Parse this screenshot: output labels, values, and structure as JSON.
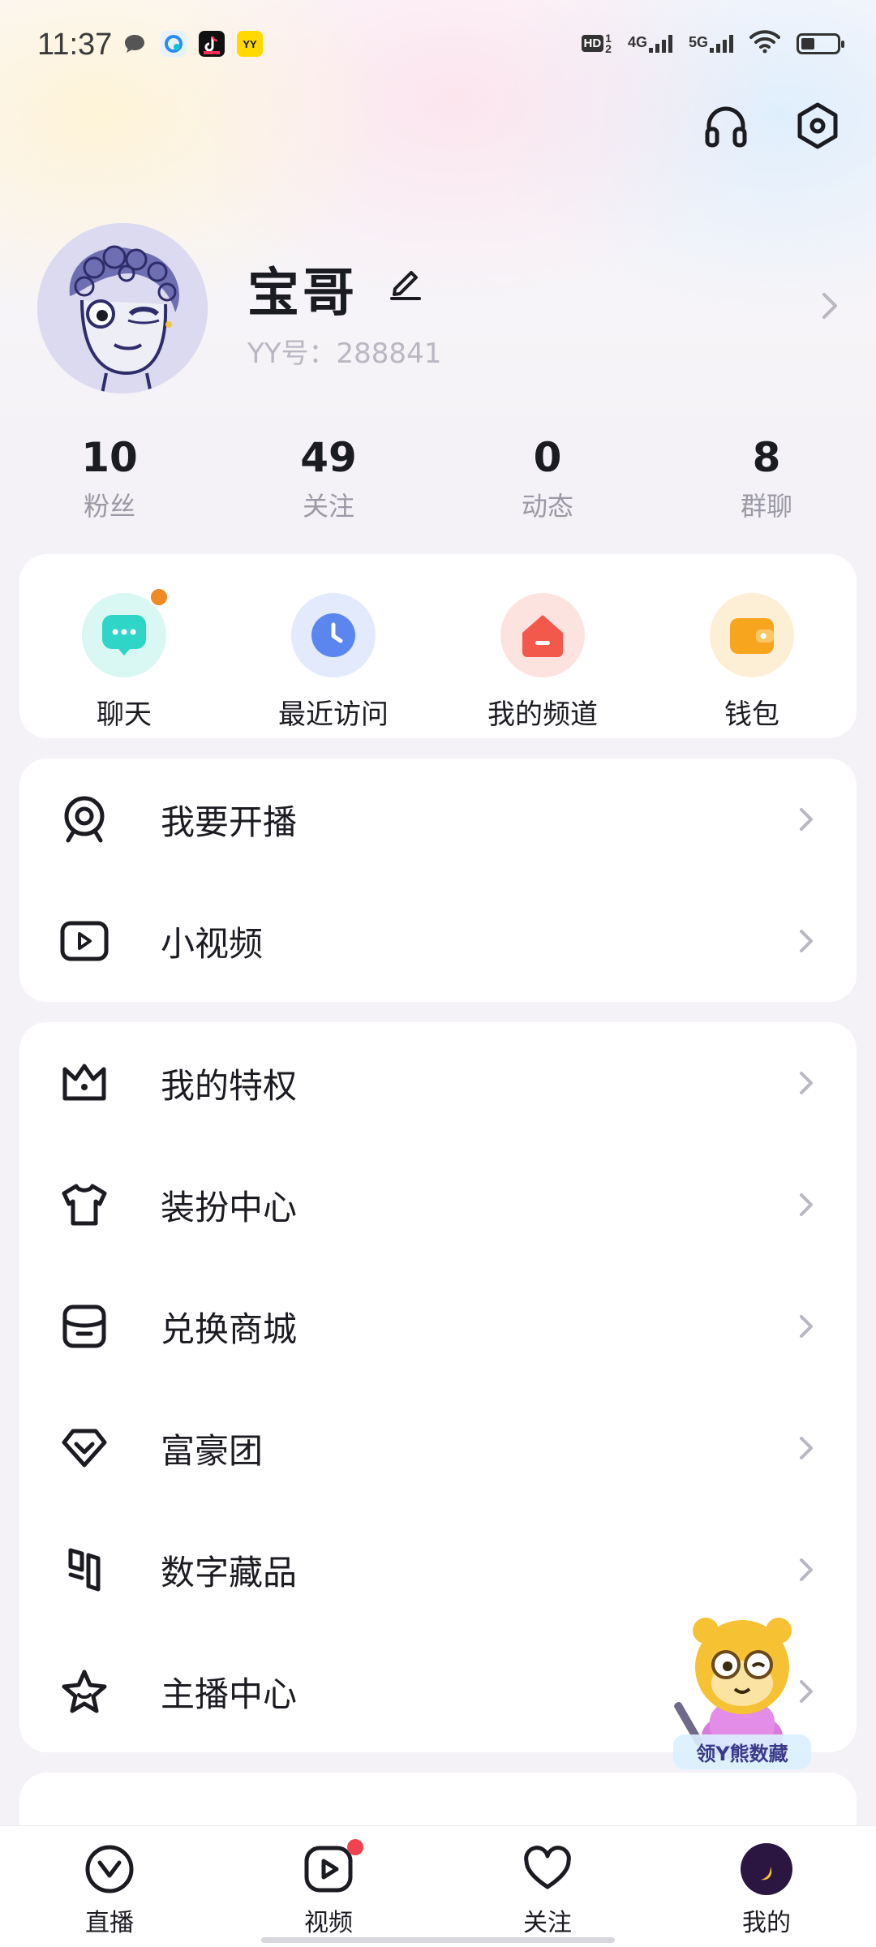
{
  "status_bar": {
    "time": "11:37",
    "signal_labels": [
      "HD",
      "4G",
      "5G"
    ],
    "icons": [
      "chat-bubble-icon",
      "cloud-app-icon",
      "tiktok-icon",
      "yy-icon",
      "wifi-icon",
      "battery-icon"
    ]
  },
  "header": {
    "icons": [
      "headset-icon",
      "settings-hexagon-icon"
    ]
  },
  "profile": {
    "name": "宝哥",
    "yy_id": "YY号：288841"
  },
  "stats": [
    {
      "value": "10",
      "label": "粉丝"
    },
    {
      "value": "49",
      "label": "关注"
    },
    {
      "value": "0",
      "label": "动态"
    },
    {
      "value": "8",
      "label": "群聊"
    }
  ],
  "quick_actions": [
    {
      "label": "聊天",
      "icon": "chat-icon",
      "color": "#2fd6c8",
      "badge": true
    },
    {
      "label": "最近访问",
      "icon": "clock-icon",
      "color": "#5b86f0",
      "badge": false
    },
    {
      "label": "我的频道",
      "icon": "house-icon",
      "color": "#f2594b",
      "badge": false
    },
    {
      "label": "钱包",
      "icon": "wallet-icon",
      "color": "#f7a41f",
      "badge": false
    }
  ],
  "menu_group_1": [
    {
      "label": "我要开播",
      "icon": "webcam-icon"
    },
    {
      "label": "小视频",
      "icon": "video-play-icon"
    }
  ],
  "menu_group_2": [
    {
      "label": "我的特权",
      "icon": "crown-icon"
    },
    {
      "label": "装扮中心",
      "icon": "tshirt-icon"
    },
    {
      "label": "兑换商城",
      "icon": "store-icon"
    },
    {
      "label": "富豪团",
      "icon": "diamond-icon"
    },
    {
      "label": "数字藏品",
      "icon": "collectible-icon"
    },
    {
      "label": "主播中心",
      "icon": "star-icon"
    }
  ],
  "mascot": {
    "caption": "领Y熊数藏"
  },
  "bottom_nav": [
    {
      "label": "直播",
      "icon": "live-icon",
      "dot": false
    },
    {
      "label": "视频",
      "icon": "video-icon",
      "dot": true
    },
    {
      "label": "关注",
      "icon": "heart-icon",
      "dot": false
    },
    {
      "label": "我的",
      "icon": "profile-avatar-icon",
      "dot": false
    }
  ],
  "colors": {
    "accent_orange": "#f08a24",
    "accent_red": "#f0434f",
    "text_primary": "#1b1b22",
    "text_secondary": "#9a99a5"
  }
}
